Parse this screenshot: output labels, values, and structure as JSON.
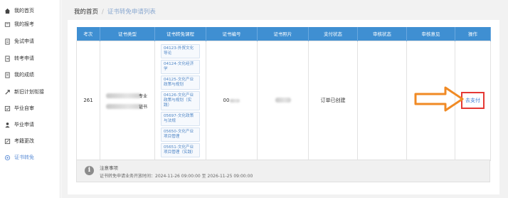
{
  "sidebar": {
    "items": [
      {
        "label": "我的首页",
        "icon": "home-icon"
      },
      {
        "label": "我的报考",
        "icon": "document-icon"
      },
      {
        "label": "免试申请",
        "icon": "form-icon"
      },
      {
        "label": "转考申请",
        "icon": "transfer-icon"
      },
      {
        "label": "我的成绩",
        "icon": "score-icon"
      },
      {
        "label": "新旧计划衔接",
        "icon": "link-icon"
      },
      {
        "label": "毕业自审",
        "icon": "audit-icon"
      },
      {
        "label": "毕业申请",
        "icon": "user-icon"
      },
      {
        "label": "考籍更改",
        "icon": "edit-icon"
      },
      {
        "label": "证书转免",
        "icon": "certificate-icon",
        "active": true
      }
    ]
  },
  "breadcrumb": {
    "home": "我的首页",
    "separator": "/",
    "current": "证书转免申请列表"
  },
  "table": {
    "headers": [
      "考次",
      "证书类型",
      "证书转免课程",
      "证书编号",
      "证书照片",
      "支付状态",
      "审核状态",
      "审核意见",
      "操作"
    ],
    "row": {
      "exam_session": "261",
      "cert_type_visible_1": "专业",
      "cert_type_visible_2": "证书",
      "courses": [
        "04123-外贸文化导论",
        "04124-文化经济学",
        "04125-文化产业政策与规划",
        "04126-文化产业政策与规划（实践）",
        "05697-文化政策与法规",
        "05650-文化产业项目管理",
        "05651-文化产业项目管理（实践）"
      ],
      "cert_number_prefix": "00",
      "pay_status": "订单已创建",
      "review_status": "",
      "review_comment": "",
      "action_label": "去支付"
    }
  },
  "notice": {
    "title": "注意事项",
    "text": "证书转免申请业务开放时间：2024-11-26 09:00:00 至 2026-11-25 09:00:00"
  },
  "colors": {
    "header_bg": "#3f8fd2",
    "link": "#4f86c6",
    "highlight_box": "#e53935",
    "arrow": "#f08a24"
  }
}
